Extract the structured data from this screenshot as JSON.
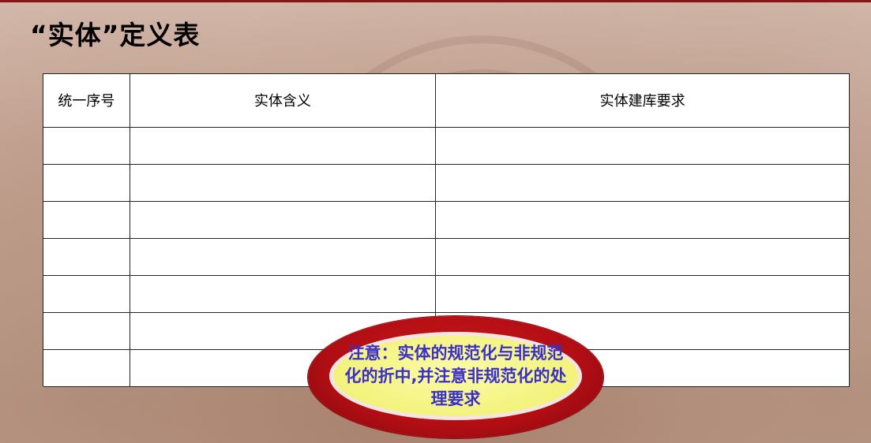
{
  "slide": {
    "title": "“实体”定义表"
  },
  "table": {
    "headers": [
      "统一序号",
      "实体含义",
      "实体建库要求"
    ],
    "rows": [
      [
        "",
        "",
        ""
      ],
      [
        "",
        "",
        ""
      ],
      [
        "",
        "",
        ""
      ],
      [
        "",
        "",
        ""
      ],
      [
        "",
        "",
        ""
      ],
      [
        "",
        "",
        ""
      ],
      [
        "",
        "",
        ""
      ]
    ]
  },
  "callout": {
    "text": "注意：实体的规范化与非规范化的折中,并注意非规范化的处理要求"
  },
  "colors": {
    "accent_red": "#b10e14",
    "callout_fill": "#f2f27a",
    "callout_text": "#3a2fc8"
  }
}
